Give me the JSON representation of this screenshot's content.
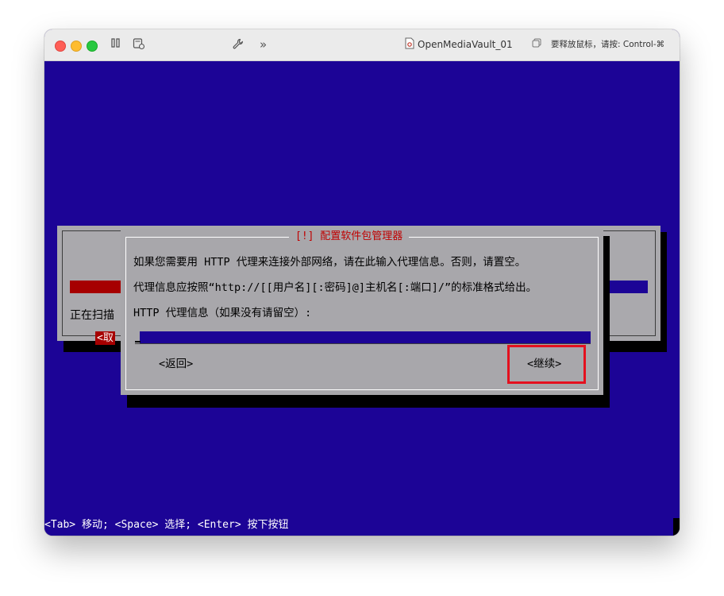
{
  "window": {
    "title": "OpenMediaVault_01",
    "release_hint": "要释放鼠标，请按: Control-⌘"
  },
  "background_dialog": {
    "status_text": "正在扫描",
    "cancel_label": "<取"
  },
  "dialog": {
    "title": "[!] 配置软件包管理器",
    "line1": "如果您需要用 HTTP 代理来连接外部网络，请在此输入代理信息。否则，请置空。",
    "line2": "代理信息应按照“http://[[用户名][:密码]@]主机名[:端口]/”的标准格式给出。",
    "field_label": "HTTP 代理信息（如果没有请留空）:",
    "field_value": "",
    "back_label": "<返回>",
    "continue_label": "<继续>"
  },
  "footer": {
    "hint": "<Tab> 移动; <Space> 选择; <Enter> 按下按钮"
  },
  "colors": {
    "screen_bg": "#1c0496",
    "dialog_bg": "#a8a7ab",
    "title_red": "#c00000",
    "highlight": "#e4101e"
  }
}
